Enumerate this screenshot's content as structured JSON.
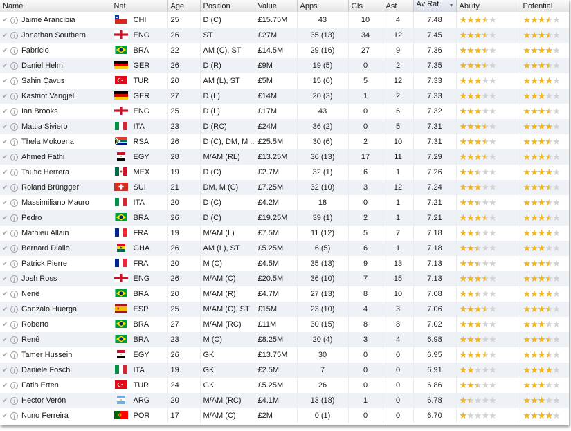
{
  "columns": [
    {
      "key": "name",
      "label": "Name"
    },
    {
      "key": "nat",
      "label": "Nat"
    },
    {
      "key": "age",
      "label": "Age"
    },
    {
      "key": "position",
      "label": "Position"
    },
    {
      "key": "value",
      "label": "Value"
    },
    {
      "key": "apps",
      "label": "Apps"
    },
    {
      "key": "gls",
      "label": "Gls"
    },
    {
      "key": "ast",
      "label": "Ast"
    },
    {
      "key": "avrat",
      "label": "Av Rat"
    },
    {
      "key": "ability",
      "label": "Ability"
    },
    {
      "key": "potential",
      "label": "Potential"
    }
  ],
  "sorted_column": "avrat",
  "colors": {
    "star_filled": "#f2b51b",
    "star_empty": "#d2d2d2",
    "row_alt": "#eef2f7"
  },
  "players": [
    {
      "name": "Jaime Arancibia",
      "nat": "CHI",
      "age": "25",
      "position": "D (C)",
      "value": "£15.75M",
      "apps": "43",
      "gls": "10",
      "ast": "4",
      "avrat": "7.48",
      "ability": 3.5,
      "potential": 3.5
    },
    {
      "name": "Jonathan Southern",
      "nat": "ENG",
      "age": "26",
      "position": "ST",
      "value": "£27M",
      "apps": "35 (13)",
      "gls": "34",
      "ast": "12",
      "avrat": "7.45",
      "ability": 3.5,
      "potential": 3.5
    },
    {
      "name": "Fabrício",
      "nat": "BRA",
      "age": "22",
      "position": "AM (C), ST",
      "value": "£14.5M",
      "apps": "29 (16)",
      "gls": "27",
      "ast": "9",
      "avrat": "7.36",
      "ability": 3.5,
      "potential": 4
    },
    {
      "name": "Daniel Helm",
      "nat": "GER",
      "age": "26",
      "position": "D (R)",
      "value": "£9M",
      "apps": "19 (5)",
      "gls": "0",
      "ast": "2",
      "avrat": "7.35",
      "ability": 3.5,
      "potential": 3.5
    },
    {
      "name": "Sahin Çavus",
      "nat": "TUR",
      "age": "20",
      "position": "AM (L), ST",
      "value": "£5M",
      "apps": "15 (6)",
      "gls": "5",
      "ast": "12",
      "avrat": "7.33",
      "ability": 3,
      "potential": 4
    },
    {
      "name": "Kastriot Vangjeli",
      "nat": "GER",
      "age": "27",
      "position": "D (L)",
      "value": "£14M",
      "apps": "20 (3)",
      "gls": "1",
      "ast": "2",
      "avrat": "7.33",
      "ability": 3,
      "potential": 3
    },
    {
      "name": "Ian Brooks",
      "nat": "ENG",
      "age": "25",
      "position": "D (L)",
      "value": "£17M",
      "apps": "43",
      "gls": "0",
      "ast": "6",
      "avrat": "7.32",
      "ability": 3,
      "potential": 3.5
    },
    {
      "name": "Mattia Siviero",
      "nat": "ITA",
      "age": "23",
      "position": "D (RC)",
      "value": "£24M",
      "apps": "36 (2)",
      "gls": "0",
      "ast": "5",
      "avrat": "7.31",
      "ability": 3.5,
      "potential": 4
    },
    {
      "name": "Thela Mokoena",
      "nat": "RSA",
      "age": "26",
      "position": "D (C), DM, M ..",
      "value": "£25.5M",
      "apps": "30 (6)",
      "gls": "2",
      "ast": "10",
      "avrat": "7.31",
      "ability": 3.5,
      "potential": 3.5
    },
    {
      "name": "Ahmed Fathi",
      "nat": "EGY",
      "age": "28",
      "position": "M/AM (RL)",
      "value": "£13.25M",
      "apps": "36 (13)",
      "gls": "17",
      "ast": "11",
      "avrat": "7.29",
      "ability": 3.5,
      "potential": 3.5
    },
    {
      "name": "Taufic Herrera",
      "nat": "MEX",
      "age": "19",
      "position": "D (C)",
      "value": "£2.7M",
      "apps": "32 (1)",
      "gls": "6",
      "ast": "1",
      "avrat": "7.26",
      "ability": 2.5,
      "potential": 4
    },
    {
      "name": "Roland Brüngger",
      "nat": "SUI",
      "age": "21",
      "position": "DM, M (C)",
      "value": "£7.25M",
      "apps": "32 (10)",
      "gls": "3",
      "ast": "12",
      "avrat": "7.24",
      "ability": 3,
      "potential": 3.5
    },
    {
      "name": "Massimiliano Mauro",
      "nat": "ITA",
      "age": "20",
      "position": "D (C)",
      "value": "£4.2M",
      "apps": "18",
      "gls": "0",
      "ast": "1",
      "avrat": "7.21",
      "ability": 2.5,
      "potential": 3.5
    },
    {
      "name": "Pedro",
      "nat": "BRA",
      "age": "26",
      "position": "D (C)",
      "value": "£19.25M",
      "apps": "39 (1)",
      "gls": "2",
      "ast": "1",
      "avrat": "7.21",
      "ability": 3.5,
      "potential": 3.5
    },
    {
      "name": "Mathieu Allain",
      "nat": "FRA",
      "age": "19",
      "position": "M/AM (L)",
      "value": "£7.5M",
      "apps": "11 (12)",
      "gls": "5",
      "ast": "7",
      "avrat": "7.18",
      "ability": 2.5,
      "potential": 4
    },
    {
      "name": "Bernard Diallo",
      "nat": "GHA",
      "age": "26",
      "position": "AM (L), ST",
      "value": "£5.25M",
      "apps": "6 (5)",
      "gls": "6",
      "ast": "1",
      "avrat": "7.18",
      "ability": 2.5,
      "potential": 3
    },
    {
      "name": "Patrick Pierre",
      "nat": "FRA",
      "age": "20",
      "position": "M (C)",
      "value": "£4.5M",
      "apps": "35 (13)",
      "gls": "9",
      "ast": "13",
      "avrat": "7.13",
      "ability": 2.5,
      "potential": 3.5
    },
    {
      "name": "Josh Ross",
      "nat": "ENG",
      "age": "26",
      "position": "M/AM (C)",
      "value": "£20.5M",
      "apps": "36 (10)",
      "gls": "7",
      "ast": "15",
      "avrat": "7.13",
      "ability": 3.5,
      "potential": 3.5
    },
    {
      "name": "Nenê",
      "nat": "BRA",
      "age": "20",
      "position": "M/AM (R)",
      "value": "£4.7M",
      "apps": "27 (13)",
      "gls": "8",
      "ast": "10",
      "avrat": "7.08",
      "ability": 2.5,
      "potential": 4
    },
    {
      "name": "Gonzalo Huerga",
      "nat": "ESP",
      "age": "25",
      "position": "M/AM (C), ST",
      "value": "£15M",
      "apps": "23 (10)",
      "gls": "4",
      "ast": "3",
      "avrat": "7.06",
      "ability": 3.5,
      "potential": 3.5
    },
    {
      "name": "Roberto",
      "nat": "BRA",
      "age": "27",
      "position": "M/AM (RC)",
      "value": "£11M",
      "apps": "30 (15)",
      "gls": "8",
      "ast": "8",
      "avrat": "7.02",
      "ability": 3,
      "potential": 3
    },
    {
      "name": "Renê",
      "nat": "BRA",
      "age": "23",
      "position": "M (C)",
      "value": "£8.25M",
      "apps": "20 (4)",
      "gls": "3",
      "ast": "4",
      "avrat": "6.98",
      "ability": 3,
      "potential": 3.5
    },
    {
      "name": "Tamer Hussein",
      "nat": "EGY",
      "age": "26",
      "position": "GK",
      "value": "£13.75M",
      "apps": "30",
      "gls": "0",
      "ast": "0",
      "avrat": "6.95",
      "ability": 3.5,
      "potential": 3.5
    },
    {
      "name": "Daniele Foschi",
      "nat": "ITA",
      "age": "19",
      "position": "GK",
      "value": "£2.5M",
      "apps": "7",
      "gls": "0",
      "ast": "0",
      "avrat": "6.91",
      "ability": 2,
      "potential": 4
    },
    {
      "name": "Fatih Erten",
      "nat": "TUR",
      "age": "24",
      "position": "GK",
      "value": "£5.25M",
      "apps": "26",
      "gls": "0",
      "ast": "0",
      "avrat": "6.86",
      "ability": 2.5,
      "potential": 3
    },
    {
      "name": "Hector Verón",
      "nat": "ARG",
      "age": "20",
      "position": "M/AM (RC)",
      "value": "£4.1M",
      "apps": "13 (18)",
      "gls": "1",
      "ast": "0",
      "avrat": "6.78",
      "ability": 1.5,
      "potential": 3
    },
    {
      "name": "Nuno Ferreira",
      "nat": "POR",
      "age": "17",
      "position": "M/AM (C)",
      "value": "£2M",
      "apps": "0 (1)",
      "gls": "0",
      "ast": "0",
      "avrat": "6.70",
      "ability": 1,
      "potential": 4
    }
  ]
}
